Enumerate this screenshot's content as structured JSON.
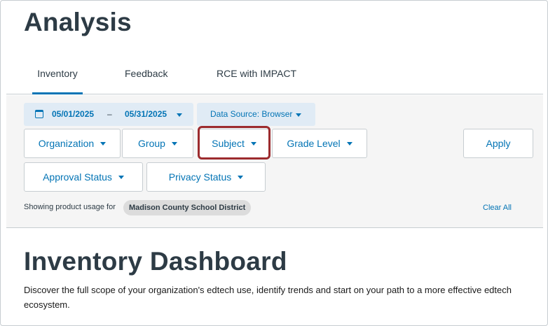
{
  "page": {
    "title": "Analysis"
  },
  "tabs": [
    {
      "label": "Inventory",
      "active": true
    },
    {
      "label": "Feedback",
      "active": false
    },
    {
      "label": "RCE with IMPACT",
      "active": false
    }
  ],
  "filters": {
    "date": {
      "start": "05/01/2025",
      "separator": "–",
      "end": "05/31/2025",
      "icon": "calendar-icon"
    },
    "data_source": {
      "label": "Data Source: Browser"
    },
    "organization": "Organization",
    "group": "Group",
    "subject": "Subject",
    "grade_level": "Grade Level",
    "apply": "Apply",
    "approval_status": "Approval Status",
    "privacy_status": "Privacy Status",
    "usage_text": "Showing product usage for",
    "district": "Madison County School District",
    "clear_all": "Clear All"
  },
  "dashboard": {
    "title": "Inventory Dashboard",
    "description": "Discover the full scope of your organization's edtech use, identify trends and start on your path to a more effective edtech ecosystem."
  },
  "colors": {
    "accent": "#0374b5",
    "highlight": "#9c2b2e",
    "pill_background": "#e0ebf5",
    "panel_background": "#f5f5f5"
  }
}
